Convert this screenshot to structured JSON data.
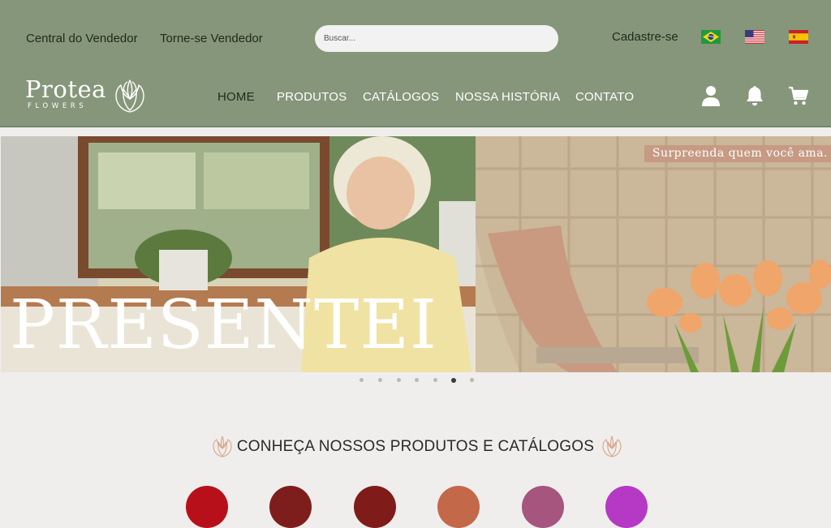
{
  "topbar": {
    "seller_center": "Central do Vendedor",
    "become_seller": "Torne-se Vendedor",
    "search_placeholder": "Buscar...",
    "signup": "Cadastre-se"
  },
  "logo": {
    "name": "Protea",
    "sub": "FLOWERS"
  },
  "nav": {
    "home": "HOME",
    "products": "PRODUTOS",
    "catalogs": "CATÁLOGOS",
    "history": "NOSSA HISTÓRIA",
    "contact": "CONTATO"
  },
  "icons": {
    "user": "user-icon",
    "bell": "bell-icon",
    "cart": "cart-icon",
    "flags": [
      "brazil-flag-icon",
      "usa-flag-icon",
      "spain-flag-icon"
    ]
  },
  "hero": {
    "tagline": "Surpreenda quem você ama.",
    "title": "PRESENTEI"
  },
  "carousel": {
    "slides": 7,
    "active": 6
  },
  "section": {
    "title": "CONHEÇA NOSSOS PRODUTOS E CATÁLOGOS"
  },
  "colors": {
    "header": "#86967a",
    "swatches": [
      "#b8101a",
      "#7e1e1c",
      "#7f1c1a",
      "#c4684a",
      "#a6557e",
      "#b539c4"
    ]
  }
}
